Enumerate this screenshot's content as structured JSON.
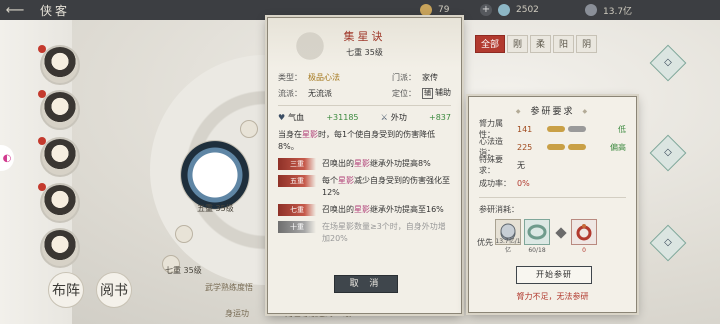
{
  "topbar": {
    "title": "侠客",
    "resources": [
      {
        "value": "79",
        "plus": "+"
      },
      {
        "value": "2502",
        "plus": ""
      },
      {
        "value": "13.7亿",
        "plus": ""
      }
    ]
  },
  "left_bubble": "◐",
  "side_buttons": [
    "布阵",
    "阅书"
  ],
  "filters": [
    "全部",
    "刚",
    "柔",
    "阳",
    "阴"
  ],
  "background_labels": {
    "node_a": "五重 35级",
    "node_b": "七重 35级",
    "footer_a": "武学熟练度悟",
    "footer_b": "身运功",
    "footer_c": "角色等级达到35级"
  },
  "modal": {
    "name": "集星诀",
    "level": "七重 35级",
    "info": {
      "type_k": "类型：",
      "type_v": "极品心法",
      "sect_k": "门派：",
      "sect_v": "家传",
      "school_k": "流派：",
      "school_v": "无流派",
      "role_k": "定位：",
      "role_flag": "辅",
      "role_v": "辅助"
    },
    "stats": {
      "hp_label": "气血",
      "hp_value": "+31185",
      "atk_label": "外功",
      "atk_value": "+837"
    },
    "desc_pre": "当身在",
    "desc_kw": "星影",
    "desc_post": "时，每1个使自身受到的伤害降低8%。",
    "tiers": [
      {
        "tag": "三重",
        "pre": "召唤出的",
        "kw": "星影",
        "post": "继承外功提高8%",
        "dim": false
      },
      {
        "tag": "五重",
        "pre": "每个",
        "kw": "星影",
        "post": "减少自身受到的伤害强化至12%",
        "dim": false
      },
      {
        "tag": "七重",
        "pre": "召唤出的",
        "kw": "星影",
        "post": "继承外功提高至16%",
        "dim": false
      },
      {
        "tag": "十重",
        "pre": "在场",
        "kw": "星影",
        "post": "数量≥3个时，自身外功增加20%",
        "dim": true
      }
    ],
    "cancel": "取 消"
  },
  "panel": {
    "title": "参研要求",
    "reqs": [
      {
        "k": "膂力属性：",
        "v": "141",
        "end": "低"
      },
      {
        "k": "心法造诣：",
        "v": "225",
        "end": "偏高"
      },
      {
        "k": "特殊要求：",
        "v": "无",
        "end": ""
      },
      {
        "k": "成功率：",
        "v": "0%",
        "end": ""
      }
    ],
    "cost_label": "参研消耗：",
    "priority": "优先",
    "items": [
      {
        "count": "13.7亿/1亿",
        "warn": false
      },
      {
        "count": "60/18",
        "warn": false
      },
      {
        "count": "0",
        "warn": true
      }
    ],
    "start": "开始参研",
    "warning": "膂力不足，无法参研"
  },
  "colors": {
    "accent": "#a03a2c",
    "gold": "#a4781d",
    "green": "#3c8a3f",
    "danger": "#b23a2f",
    "dark_btn": "#3f464c"
  }
}
